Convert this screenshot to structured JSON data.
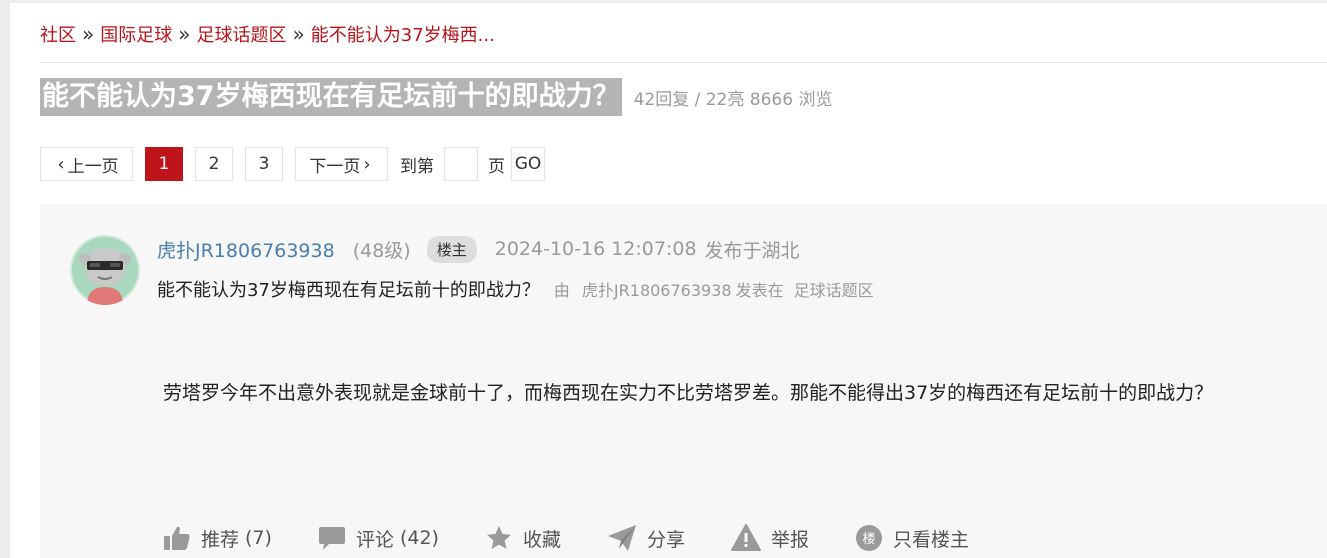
{
  "breadcrumb": {
    "items": [
      "社区",
      "国际足球",
      "足球话题区",
      "能不能认为37岁梅西..."
    ],
    "separator": "»"
  },
  "thread": {
    "title": "能不能认为37岁梅西现在有足坛前十的即战力？",
    "meta": "42回复 / 22亮 8666 浏览"
  },
  "pager": {
    "prev_label": "上一页",
    "pages": [
      "1",
      "2",
      "3"
    ],
    "current_page": "1",
    "next_label": "下一页",
    "goto_label": "到第",
    "page_label": "页",
    "go_label": "GO",
    "goto_value": ""
  },
  "post": {
    "username": "虎扑JR1806763938",
    "level": "(48级)",
    "op_badge": "楼主",
    "time": "2024-10-16 12:07:08",
    "location": "发布于湖北",
    "subtitle": "能不能认为37岁梅西现在有足坛前十的即战力？",
    "by_label": "由",
    "by_user": "虎扑JR1806763938",
    "posted_in": "发表在",
    "forum": "足球话题区",
    "body": "劳塔罗今年不出意外表现就是金球前十了，而梅西现在实力不比劳塔罗差。那能不能得出37岁的梅西还有足坛前十的即战力？",
    "actions": {
      "recommend_label": "推荐",
      "recommend_count": "(7)",
      "comment_label": "评论",
      "comment_count": "(42)",
      "favorite_label": "收藏",
      "share_label": "分享",
      "report_label": "举报",
      "op_only_label": "只看楼主",
      "op_only_glyph": "楼"
    }
  },
  "icons": {
    "recommend": "thumbs-up-icon",
    "comment": "comment-bubble-icon",
    "favorite": "star-icon",
    "share": "paper-plane-icon",
    "report": "warning-triangle-icon",
    "op_only": "floor-badge-icon"
  },
  "colors": {
    "link_red": "#b8141a",
    "active_page": "#c0141b",
    "username_blue": "#4a7fb0",
    "title_bg": "#b4b4b4",
    "post_bg": "#f7f7f7",
    "icon_gray": "#9a9a9a"
  }
}
